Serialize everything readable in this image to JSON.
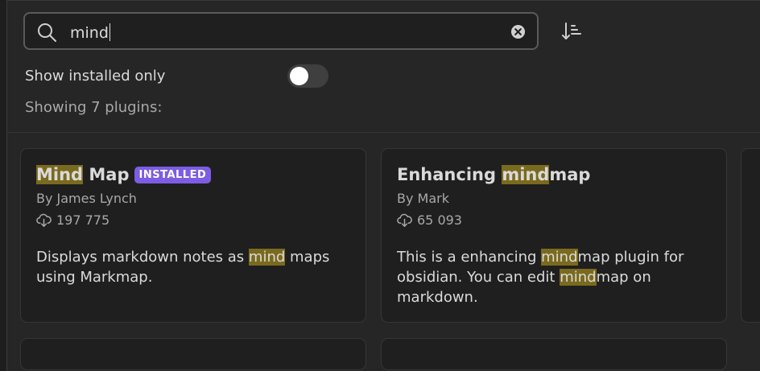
{
  "search": {
    "value": "mind"
  },
  "filter": {
    "toggle_label": "Show installed only",
    "toggle_on": false
  },
  "results": {
    "count_text": "Showing 7 plugins:"
  },
  "plugins": [
    {
      "title_parts": [
        {
          "text": "Mind",
          "highlight": true
        },
        {
          "text": " Map",
          "highlight": false
        }
      ],
      "badge": "INSTALLED",
      "author": "By James Lynch",
      "downloads": "197 775",
      "description_parts": [
        {
          "text": "Displays markdown notes as ",
          "highlight": false
        },
        {
          "text": "mind",
          "highlight": true
        },
        {
          "text": " maps using Markmap.",
          "highlight": false
        }
      ]
    },
    {
      "title_parts": [
        {
          "text": "Enhancing ",
          "highlight": false
        },
        {
          "text": "mind",
          "highlight": true
        },
        {
          "text": "map",
          "highlight": false
        }
      ],
      "badge": "",
      "author": "By Mark",
      "downloads": "65 093",
      "description_parts": [
        {
          "text": "This is a enhancing ",
          "highlight": false
        },
        {
          "text": "mind",
          "highlight": true
        },
        {
          "text": "map plugin for obsidian. You can edit ",
          "highlight": false
        },
        {
          "text": "mind",
          "highlight": true
        },
        {
          "text": "map on markdown.",
          "highlight": false
        }
      ]
    }
  ],
  "colors": {
    "background": "#262626",
    "card": "#1f1f1f",
    "highlight": "#7a6a1e",
    "badge": "#7c5de3"
  },
  "icons": {
    "search": "search-icon",
    "clear": "clear-circle-icon",
    "sort": "sort-icon",
    "download": "download-icon"
  }
}
